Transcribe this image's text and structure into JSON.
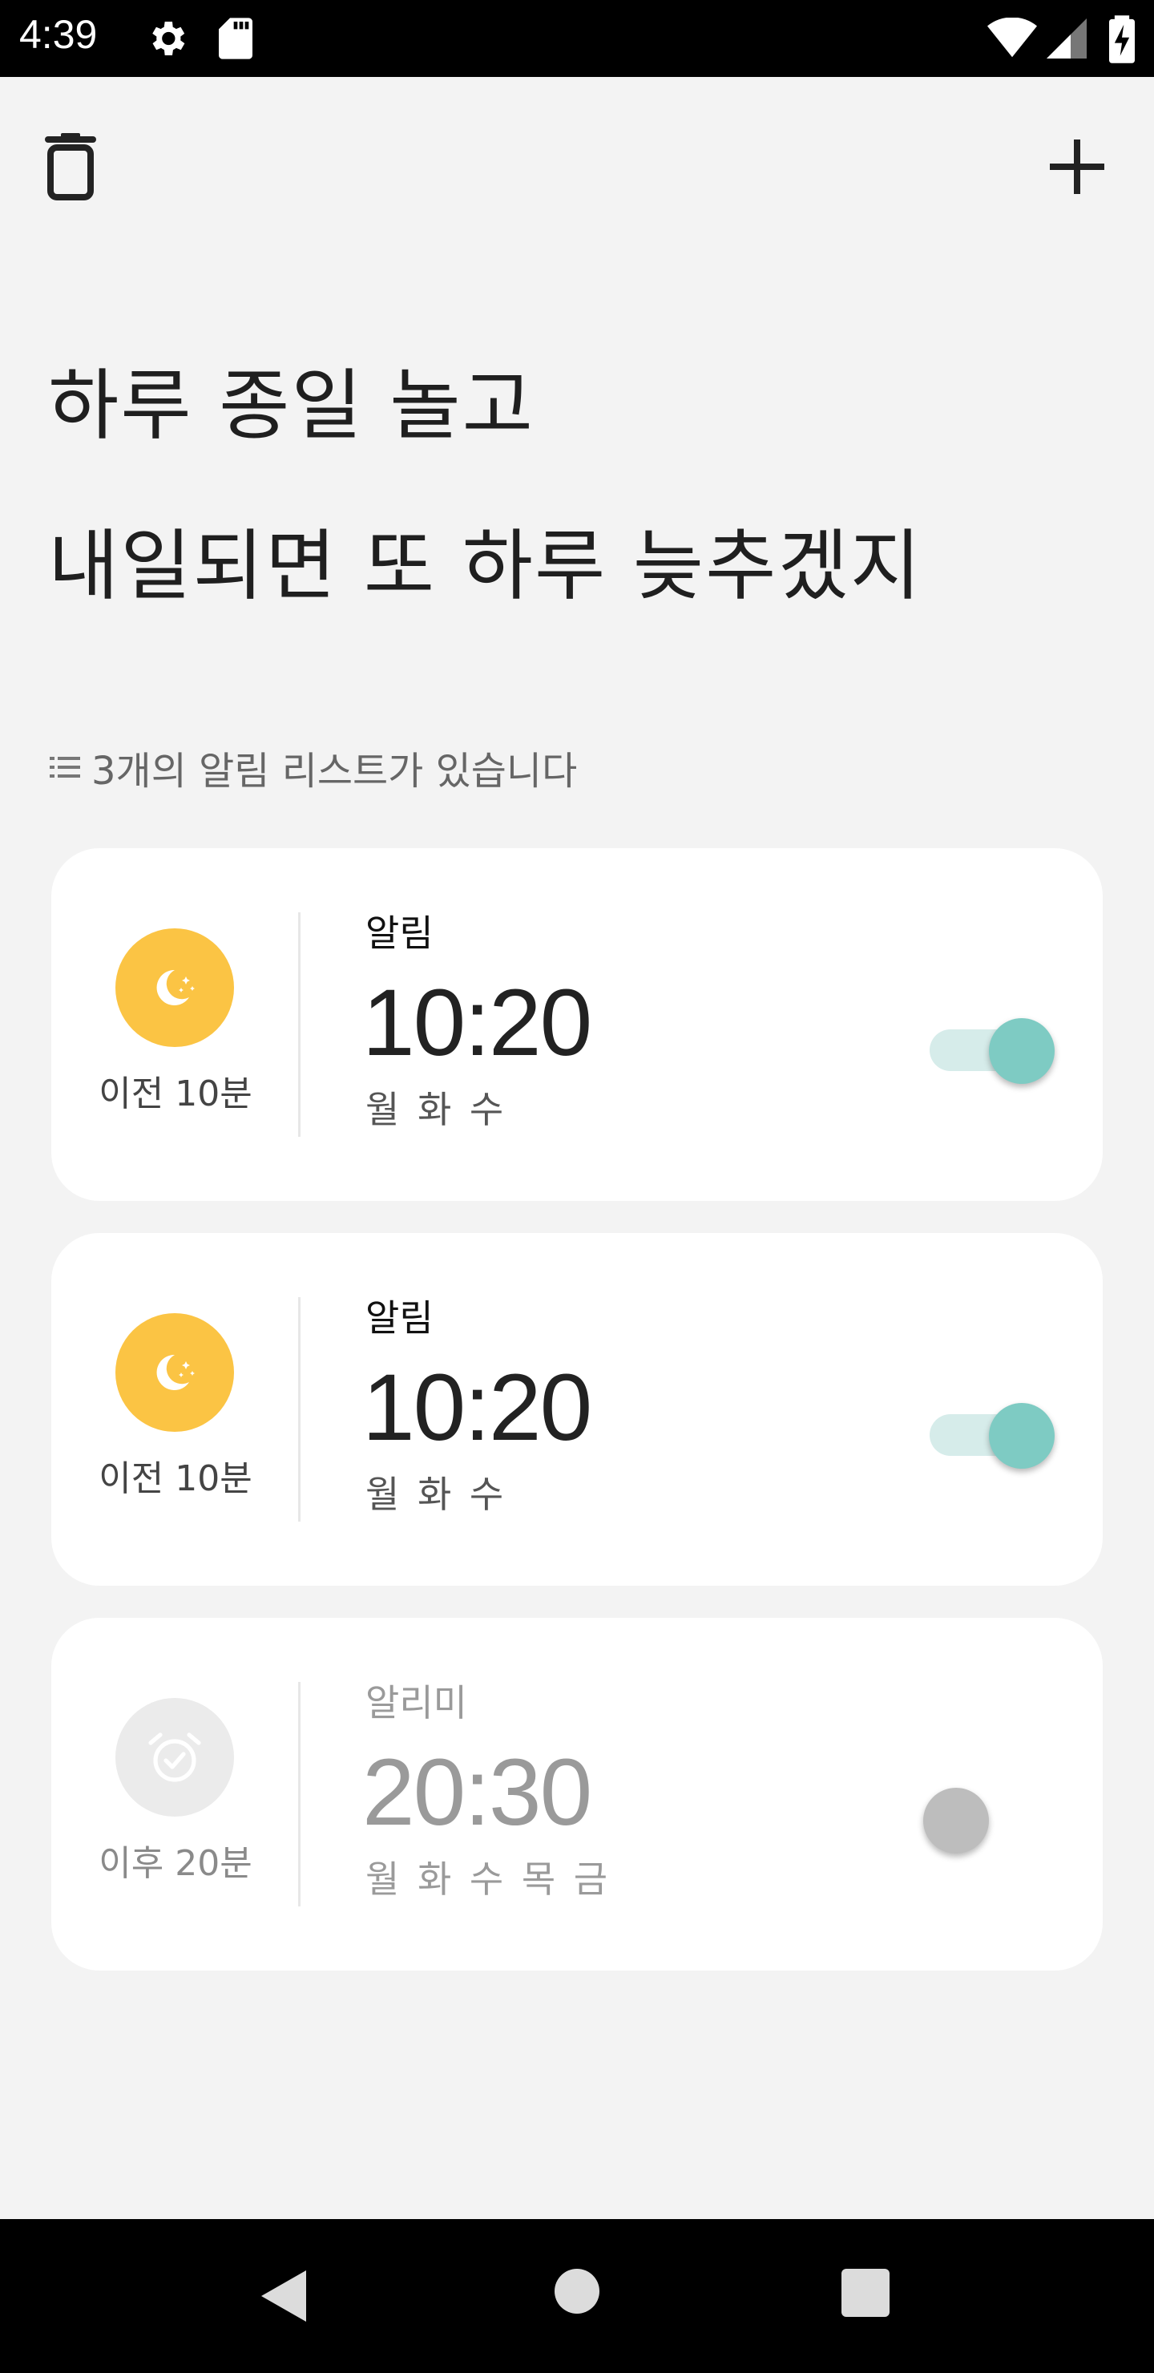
{
  "status_bar": {
    "time": "4:39",
    "icons": [
      "settings-gear-icon",
      "sd-card-icon",
      "wifi-icon",
      "cell-signal-icon",
      "battery-charging-icon"
    ]
  },
  "app_bar": {
    "left_icon": "trash-icon",
    "right_icon": "plus-icon"
  },
  "headline": {
    "line1": "하루 종일 놀고",
    "line2": "내일되면 또 하루 늦추겠지"
  },
  "list_summary": {
    "icon": "list-icon",
    "text": "3개의 알림 리스트가 있습니다"
  },
  "alarms": [
    {
      "badge_icon": "moon-stars-icon",
      "offset_label": "이전 10분",
      "name": "알림",
      "time": "10:20",
      "days": "월 화 수",
      "enabled": true
    },
    {
      "badge_icon": "moon-stars-icon",
      "offset_label": "이전 10분",
      "name": "알림",
      "time": "10:20",
      "days": "월 화 수",
      "enabled": true
    },
    {
      "badge_icon": "alarm-clock-check-icon",
      "offset_label": "이후 20분",
      "name": "알리미",
      "time": "20:30",
      "days": "월 화 수 목 금",
      "enabled": false
    }
  ],
  "colors": {
    "background": "#f3f3f3",
    "card": "#ffffff",
    "badge_active": "#fbc444",
    "badge_inactive": "#ebebeb",
    "toggle_on_thumb": "#7ecbc3",
    "toggle_on_track": "#d6ecea",
    "toggle_off_thumb": "#bdbdbd"
  },
  "nav_bar": {
    "icons": [
      "back-icon",
      "home-icon",
      "recents-icon"
    ]
  }
}
